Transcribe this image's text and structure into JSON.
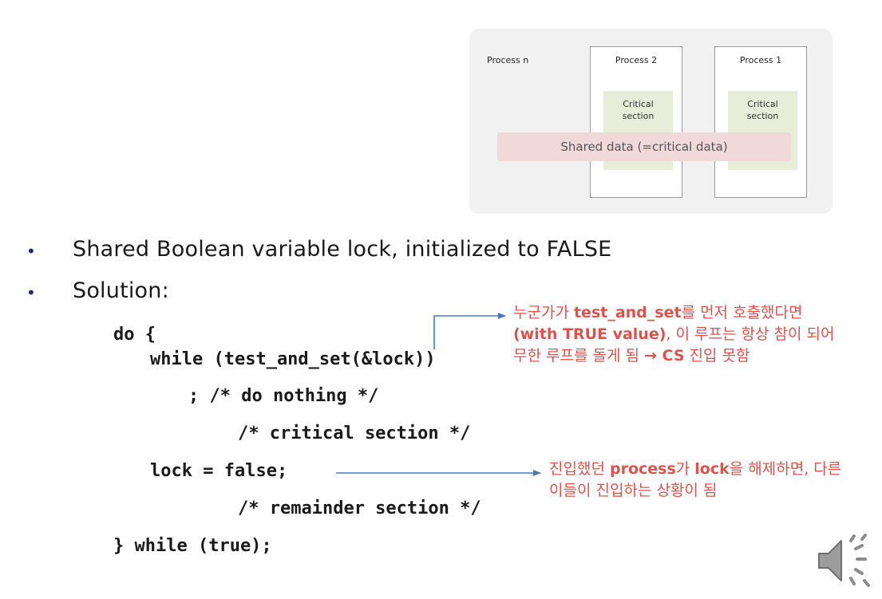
{
  "diagram": {
    "process_n": "Process n",
    "process_2": "Process 2",
    "process_1": "Process 1",
    "critical_section_2": "Critical\nsection",
    "critical_section_1": "Critical\nsection",
    "shared_data": "Shared data (=critical data)"
  },
  "bullets": [
    {
      "text": "Shared Boolean variable lock, initialized to FALSE"
    },
    {
      "text": "Solution:"
    }
  ],
  "code": {
    "line1": "do {",
    "line2": "while (test_and_set(&lock))",
    "line3": "; /* do nothing */",
    "line4": "/* critical section */",
    "line5": "lock = false;",
    "line6": "/* remainder section */",
    "line7": "} while (true);"
  },
  "notes": {
    "note1_l1_a": "누군가가 ",
    "note1_l1_b": "test_and_set",
    "note1_l1_c": "를 먼저 호출했다면",
    "note1_l2_a": "(with TRUE value)",
    "note1_l2_b": ", 이 루프는 항상 참이 되어",
    "note1_l3_a": "무한 루프를 돌게 됨 ",
    "note1_l3_b": "→ CS",
    "note1_l3_c": " 진입 못함",
    "note2_l1_a": "진입했던 ",
    "note2_l1_b": "process",
    "note2_l1_c": "가 ",
    "note2_l1_d": "lock",
    "note2_l1_e": "을 해제하면, 다른",
    "note2_l2": "이들이 진입하는 상황이 됨"
  },
  "colors": {
    "annotation": "#d9534f",
    "arrow": "#4a7ab5",
    "bullet": "#1a2a6b"
  },
  "icons": {
    "speaker": "speaker-icon"
  }
}
